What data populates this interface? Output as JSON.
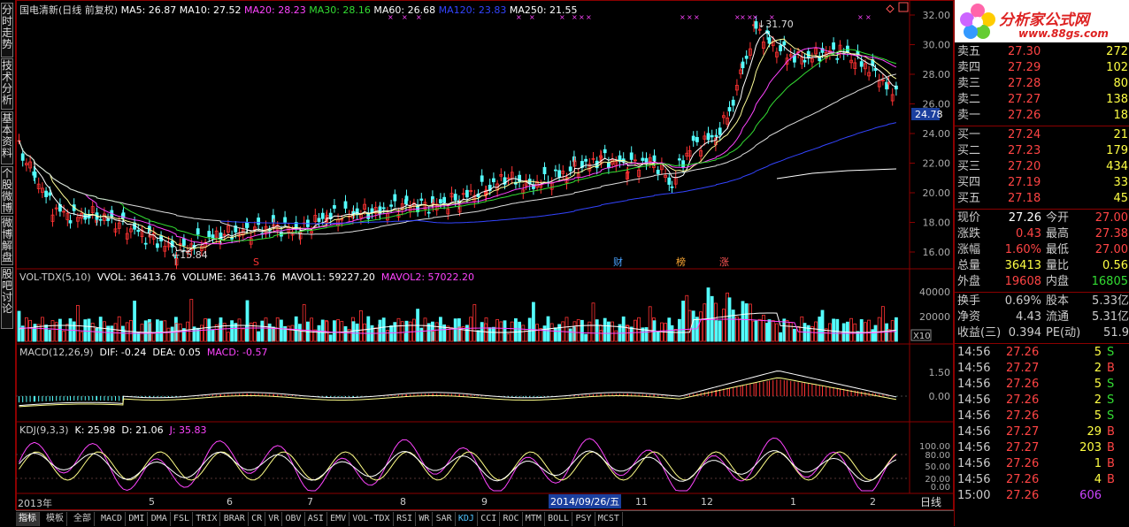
{
  "side_tabs": [
    "分时走势",
    "技术分析",
    "基本资料",
    "个股微博",
    "微博解盘",
    "股吧讨论"
  ],
  "main_header": {
    "title": "国电清新(日线 前复权)",
    "ma": [
      {
        "label": "MA5: 26.87",
        "color": "#ffffff"
      },
      {
        "label": "MA10: 27.52",
        "color": "#ffffff"
      },
      {
        "label": "MA20: 28.23",
        "color": "#ff44ff"
      },
      {
        "label": "MA30: 28.16",
        "color": "#33dd33"
      },
      {
        "label": "MA60: 26.68",
        "color": "#ffffff"
      },
      {
        "label": "MA120: 23.83",
        "color": "#3344ff"
      },
      {
        "label": "MA250: 21.55",
        "color": "#ffffff"
      }
    ]
  },
  "price_axis": [
    "32.00",
    "30.00",
    "28.00",
    "26.00",
    "24.00",
    "22.00",
    "20.00",
    "18.00",
    "16.00"
  ],
  "current_price_tag": "24.78",
  "price_annotations": {
    "high": "31.70",
    "low": "15.84"
  },
  "event_markers": [
    {
      "text": "S",
      "color": "#ff3333"
    },
    {
      "text": "财",
      "color": "#4aa3ff"
    },
    {
      "text": "榜",
      "color": "#ffaa33"
    },
    {
      "text": "涨",
      "color": "#ff5555"
    }
  ],
  "vol_header": {
    "items": [
      {
        "label": "VOL-TDX(5,10)",
        "color": "#cccccc"
      },
      {
        "label": "VVOL: 36413.76",
        "color": "#ffffff"
      },
      {
        "label": "VOLUME: 36413.76",
        "color": "#ffffff"
      },
      {
        "label": "MAVOL1: 59227.20",
        "color": "#ffffff"
      },
      {
        "label": "MAVOL2: 57022.20",
        "color": "#ff44ff"
      }
    ]
  },
  "vol_axis": [
    "40000",
    "20000"
  ],
  "vol_unit": "X10",
  "macd_header": {
    "items": [
      {
        "label": "MACD(12,26,9)",
        "color": "#cccccc"
      },
      {
        "label": "DIF: -0.24",
        "color": "#ffffff"
      },
      {
        "label": "DEA: 0.05",
        "color": "#ffffff"
      },
      {
        "label": "MACD: -0.57",
        "color": "#ff44ff"
      }
    ]
  },
  "macd_axis": [
    "1.50",
    "0.00"
  ],
  "kdj_header": {
    "items": [
      {
        "label": "KDJ(9,3,3)",
        "color": "#cccccc"
      },
      {
        "label": "K: 25.98",
        "color": "#ffffff"
      },
      {
        "label": "D: 21.06",
        "color": "#ffffff"
      },
      {
        "label": "J: 35.83",
        "color": "#ff44ff"
      }
    ]
  },
  "kdj_axis": [
    "100.00",
    "80.00",
    "50.00",
    "20.00",
    "0.00"
  ],
  "x_axis": [
    "2013年",
    "5",
    "6",
    "7",
    "8",
    "9",
    "11",
    "12",
    "1",
    "2"
  ],
  "cursor_date": "2014/09/26/五",
  "period_label": "日线",
  "bottom_tabs": [
    "指标",
    "模板",
    "全部",
    "MACD",
    "DMI",
    "DMA",
    "FSL",
    "TRIX",
    "BRAR",
    "CR",
    "VR",
    "OBV",
    "ASI",
    "EMV",
    "VOL-TDX",
    "RSI",
    "WR",
    "SAR",
    "KDJ",
    "CCI",
    "ROC",
    "MTM",
    "BOLL",
    "PSY",
    "MCST"
  ],
  "order_book": {
    "sell": [
      {
        "label": "卖五",
        "price": "27.30",
        "vol": "272"
      },
      {
        "label": "卖四",
        "price": "27.29",
        "vol": "102"
      },
      {
        "label": "卖三",
        "price": "27.28",
        "vol": "80"
      },
      {
        "label": "卖二",
        "price": "27.27",
        "vol": "138"
      },
      {
        "label": "卖一",
        "price": "27.26",
        "vol": "18"
      }
    ],
    "buy": [
      {
        "label": "买一",
        "price": "27.24",
        "vol": "21"
      },
      {
        "label": "买二",
        "price": "27.23",
        "vol": "179"
      },
      {
        "label": "买三",
        "price": "27.20",
        "vol": "434"
      },
      {
        "label": "买四",
        "price": "27.19",
        "vol": "33"
      },
      {
        "label": "买五",
        "price": "27.18",
        "vol": "45"
      }
    ]
  },
  "quote": [
    {
      "l1": "现价",
      "v1": "27.26",
      "c1": "#ffffff",
      "l2": "今开",
      "v2": "27.00",
      "c2": "#ff4444"
    },
    {
      "l1": "涨跌",
      "v1": "0.43",
      "c1": "#ff4444",
      "l2": "最高",
      "v2": "27.38",
      "c2": "#ff4444"
    },
    {
      "l1": "涨幅",
      "v1": "1.60%",
      "c1": "#ff4444",
      "l2": "最低",
      "v2": "27.00",
      "c2": "#ff4444"
    },
    {
      "l1": "总量",
      "v1": "36413",
      "c1": "#ffff44",
      "l2": "量比",
      "v2": "0.56",
      "c2": "#ffff44"
    },
    {
      "l1": "外盘",
      "v1": "19608",
      "c1": "#ff4444",
      "l2": "内盘",
      "v2": "16805",
      "c2": "#33dd33"
    }
  ],
  "stats": [
    {
      "l1": "换手",
      "v1": "0.69%",
      "l2": "股本",
      "v2": "5.33亿"
    },
    {
      "l1": "净资",
      "v1": "4.43",
      "l2": "流通",
      "v2": "5.31亿"
    },
    {
      "l1": "收益(三)",
      "v1": "0.394",
      "l2": "PE(动)",
      "v2": "51.9"
    }
  ],
  "ticks": [
    {
      "time": "14:56",
      "price": "27.26",
      "vol": "5",
      "side": "S"
    },
    {
      "time": "14:56",
      "price": "27.27",
      "vol": "2",
      "side": "B"
    },
    {
      "time": "14:56",
      "price": "27.26",
      "vol": "5",
      "side": "S"
    },
    {
      "time": "14:56",
      "price": "27.26",
      "vol": "2",
      "side": "S"
    },
    {
      "time": "14:56",
      "price": "27.26",
      "vol": "5",
      "side": "S"
    },
    {
      "time": "14:56",
      "price": "27.27",
      "vol": "29",
      "side": "B"
    },
    {
      "time": "14:56",
      "price": "27.27",
      "vol": "203",
      "side": "B"
    },
    {
      "time": "14:56",
      "price": "27.26",
      "vol": "1",
      "side": "B"
    },
    {
      "time": "14:56",
      "price": "27.26",
      "vol": "4",
      "side": "B"
    },
    {
      "time": "15:00",
      "price": "27.26",
      "vol": "606",
      "side": ""
    }
  ],
  "logo": {
    "brand": "分析家公式网",
    "url": "www.88gs.com"
  }
}
